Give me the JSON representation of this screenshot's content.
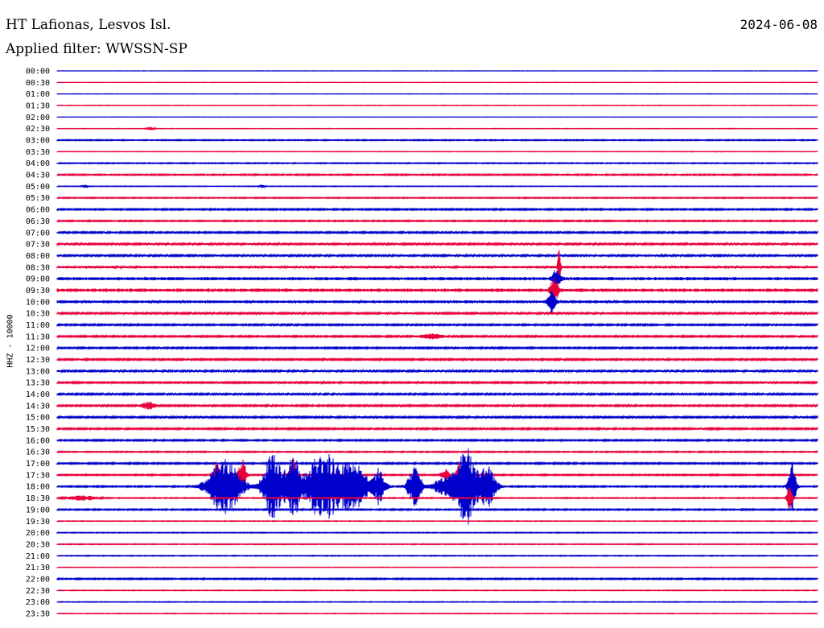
{
  "header": {
    "station": "HT Lafionas, Lesvos Isl.",
    "date": "2024-06-08",
    "filter": "Applied filter: WWSSN-SP"
  },
  "chart_data": {
    "type": "line",
    "title": "HT Lafionas, Lesvos Isl.",
    "subtitle": "Applied filter: WWSSN-SP",
    "date": "2024-06-08",
    "ylabel": "HHZ - 10000",
    "row_labels": [
      "00:00",
      "00:30",
      "01:00",
      "01:30",
      "02:00",
      "02:30",
      "03:00",
      "03:30",
      "04:00",
      "04:30",
      "05:00",
      "05:30",
      "06:00",
      "06:30",
      "07:00",
      "07:30",
      "08:00",
      "08:30",
      "09:00",
      "09:30",
      "10:00",
      "10:30",
      "11:00",
      "11:30",
      "12:00",
      "12:30",
      "13:00",
      "13:30",
      "14:00",
      "14:30",
      "15:00",
      "15:30",
      "16:00",
      "16:30",
      "17:00",
      "17:30",
      "18:00",
      "18:30",
      "19:00",
      "19:30",
      "20:00",
      "20:30",
      "21:00",
      "21:30",
      "22:00",
      "22:30",
      "23:00",
      "23:30"
    ],
    "colors": [
      "#0000cc",
      "#e8003a"
    ],
    "grid": false,
    "x_unit": "minutes within each 30-minute row",
    "noise_level": [
      0.2,
      0.2,
      0.2,
      0.3,
      0.2,
      0.3,
      0.6,
      0.3,
      0.6,
      0.8,
      0.4,
      0.6,
      0.9,
      0.8,
      1.0,
      1.2,
      1.2,
      1.6,
      2.0,
      2.1,
      1.8,
      1.2,
      1.0,
      1.0,
      1.0,
      1.0,
      1.2,
      1.0,
      1.1,
      1.0,
      1.1,
      1.0,
      0.9,
      0.7,
      0.9,
      0.8,
      0.8,
      0.6,
      0.8,
      0.4,
      0.5,
      0.5,
      0.5,
      0.3,
      0.8,
      0.4,
      0.4,
      0.4
    ],
    "events": [
      {
        "row": 5,
        "minute": 3.7,
        "amplitude": 2,
        "duration": 0.3
      },
      {
        "row": 10,
        "minute": 1.1,
        "amplitude": 2,
        "duration": 0.2
      },
      {
        "row": 10,
        "minute": 8.1,
        "amplitude": 2,
        "duration": 0.2
      },
      {
        "row": 17,
        "minute": 19.8,
        "amplitude": 34,
        "duration": 0.1
      },
      {
        "row": 18,
        "minute": 19.7,
        "amplitude": 12,
        "duration": 0.3
      },
      {
        "row": 19,
        "minute": 19.6,
        "amplitude": 16,
        "duration": 0.3
      },
      {
        "row": 20,
        "minute": 19.5,
        "amplitude": 14,
        "duration": 0.3
      },
      {
        "row": 23,
        "minute": 14.8,
        "amplitude": 3,
        "duration": 1.0
      },
      {
        "row": 29,
        "minute": 3.6,
        "amplitude": 4,
        "duration": 0.6
      },
      {
        "row": 35,
        "minute": 6.3,
        "amplitude": 16,
        "duration": 0.3
      },
      {
        "row": 35,
        "minute": 7.3,
        "amplitude": 22,
        "duration": 0.3
      },
      {
        "row": 35,
        "minute": 9.3,
        "amplitude": 20,
        "duration": 0.3
      },
      {
        "row": 35,
        "minute": 15.3,
        "amplitude": 8,
        "duration": 0.3
      },
      {
        "row": 35,
        "minute": 15.9,
        "amplitude": 18,
        "duration": 0.3
      },
      {
        "row": 36,
        "minute": 6.6,
        "amplitude": 35,
        "duration": 1.3
      },
      {
        "row": 36,
        "minute": 8.5,
        "amplitude": 40,
        "duration": 0.8
      },
      {
        "row": 36,
        "minute": 9.3,
        "amplitude": 38,
        "duration": 0.6
      },
      {
        "row": 36,
        "minute": 10.5,
        "amplitude": 45,
        "duration": 1.4
      },
      {
        "row": 36,
        "minute": 11.5,
        "amplitude": 28,
        "duration": 0.8
      },
      {
        "row": 36,
        "minute": 12.0,
        "amplitude": 22,
        "duration": 0.6
      },
      {
        "row": 36,
        "minute": 12.7,
        "amplitude": 24,
        "duration": 0.5
      },
      {
        "row": 36,
        "minute": 14.1,
        "amplitude": 28,
        "duration": 0.5
      },
      {
        "row": 36,
        "minute": 15.5,
        "amplitude": 16,
        "duration": 1.2
      },
      {
        "row": 36,
        "minute": 16.2,
        "amplitude": 45,
        "duration": 0.8
      },
      {
        "row": 36,
        "minute": 17.0,
        "amplitude": 30,
        "duration": 0.6
      },
      {
        "row": 36,
        "minute": 29.0,
        "amplitude": 28,
        "duration": 0.3
      },
      {
        "row": 37,
        "minute": 1.0,
        "amplitude": 3,
        "duration": 1.2
      },
      {
        "row": 37,
        "minute": 28.9,
        "amplitude": 20,
        "duration": 0.2
      }
    ]
  }
}
